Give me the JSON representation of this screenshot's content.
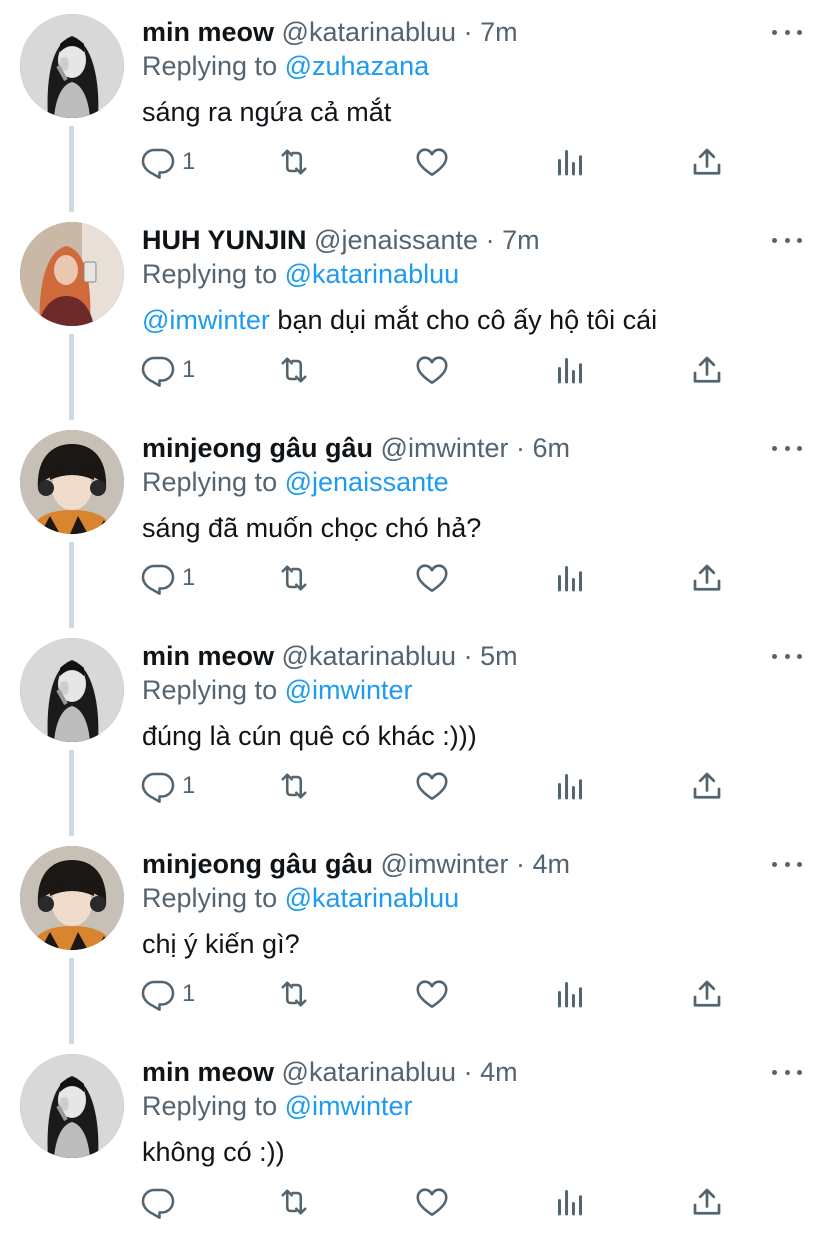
{
  "colors": {
    "accent": "#1d9bf0",
    "muted": "#536471",
    "text": "#0f1419",
    "line": "#cfd9de"
  },
  "icons": {
    "reply": "reply-icon",
    "retweet": "retweet-icon",
    "like": "heart-icon",
    "views": "views-icon",
    "share": "share-icon",
    "more": "more-icon"
  },
  "tweets": [
    {
      "name": "min meow",
      "handle": "@katarinabluu",
      "dot": "·",
      "time": "7m",
      "replying_label": "Replying to",
      "replying_to": "@zuhazana",
      "mention": "",
      "text": "sáng ra ngứa cả mắt",
      "reply_count": "1"
    },
    {
      "name": "HUH YUNJIN",
      "handle": "@jenaissante",
      "dot": "·",
      "time": "7m",
      "replying_label": "Replying to",
      "replying_to": "@katarinabluu",
      "mention": "@imwinter",
      "text": " bạn dụi mắt cho cô ấy hộ tôi cái",
      "reply_count": "1"
    },
    {
      "name": "minjeong gâu gâu",
      "handle": "@imwinter",
      "dot": "·",
      "time": "6m",
      "replying_label": "Replying to",
      "replying_to": "@jenaissante",
      "mention": "",
      "text": "sáng đã muốn chọc chó hả?",
      "reply_count": "1"
    },
    {
      "name": "min meow",
      "handle": "@katarinabluu",
      "dot": "·",
      "time": "5m",
      "replying_label": "Replying to",
      "replying_to": "@imwinter",
      "mention": "",
      "text": "đúng là cún quê có khác :)))",
      "reply_count": "1"
    },
    {
      "name": "minjeong gâu gâu",
      "handle": "@imwinter",
      "dot": "·",
      "time": "4m",
      "replying_label": "Replying to",
      "replying_to": "@katarinabluu",
      "mention": "",
      "text": "chị ý kiến gì?",
      "reply_count": "1"
    },
    {
      "name": "min meow",
      "handle": "@katarinabluu",
      "dot": "·",
      "time": "4m",
      "replying_label": "Replying to",
      "replying_to": "@imwinter",
      "mention": "",
      "text": "không có :))",
      "reply_count": ""
    }
  ]
}
